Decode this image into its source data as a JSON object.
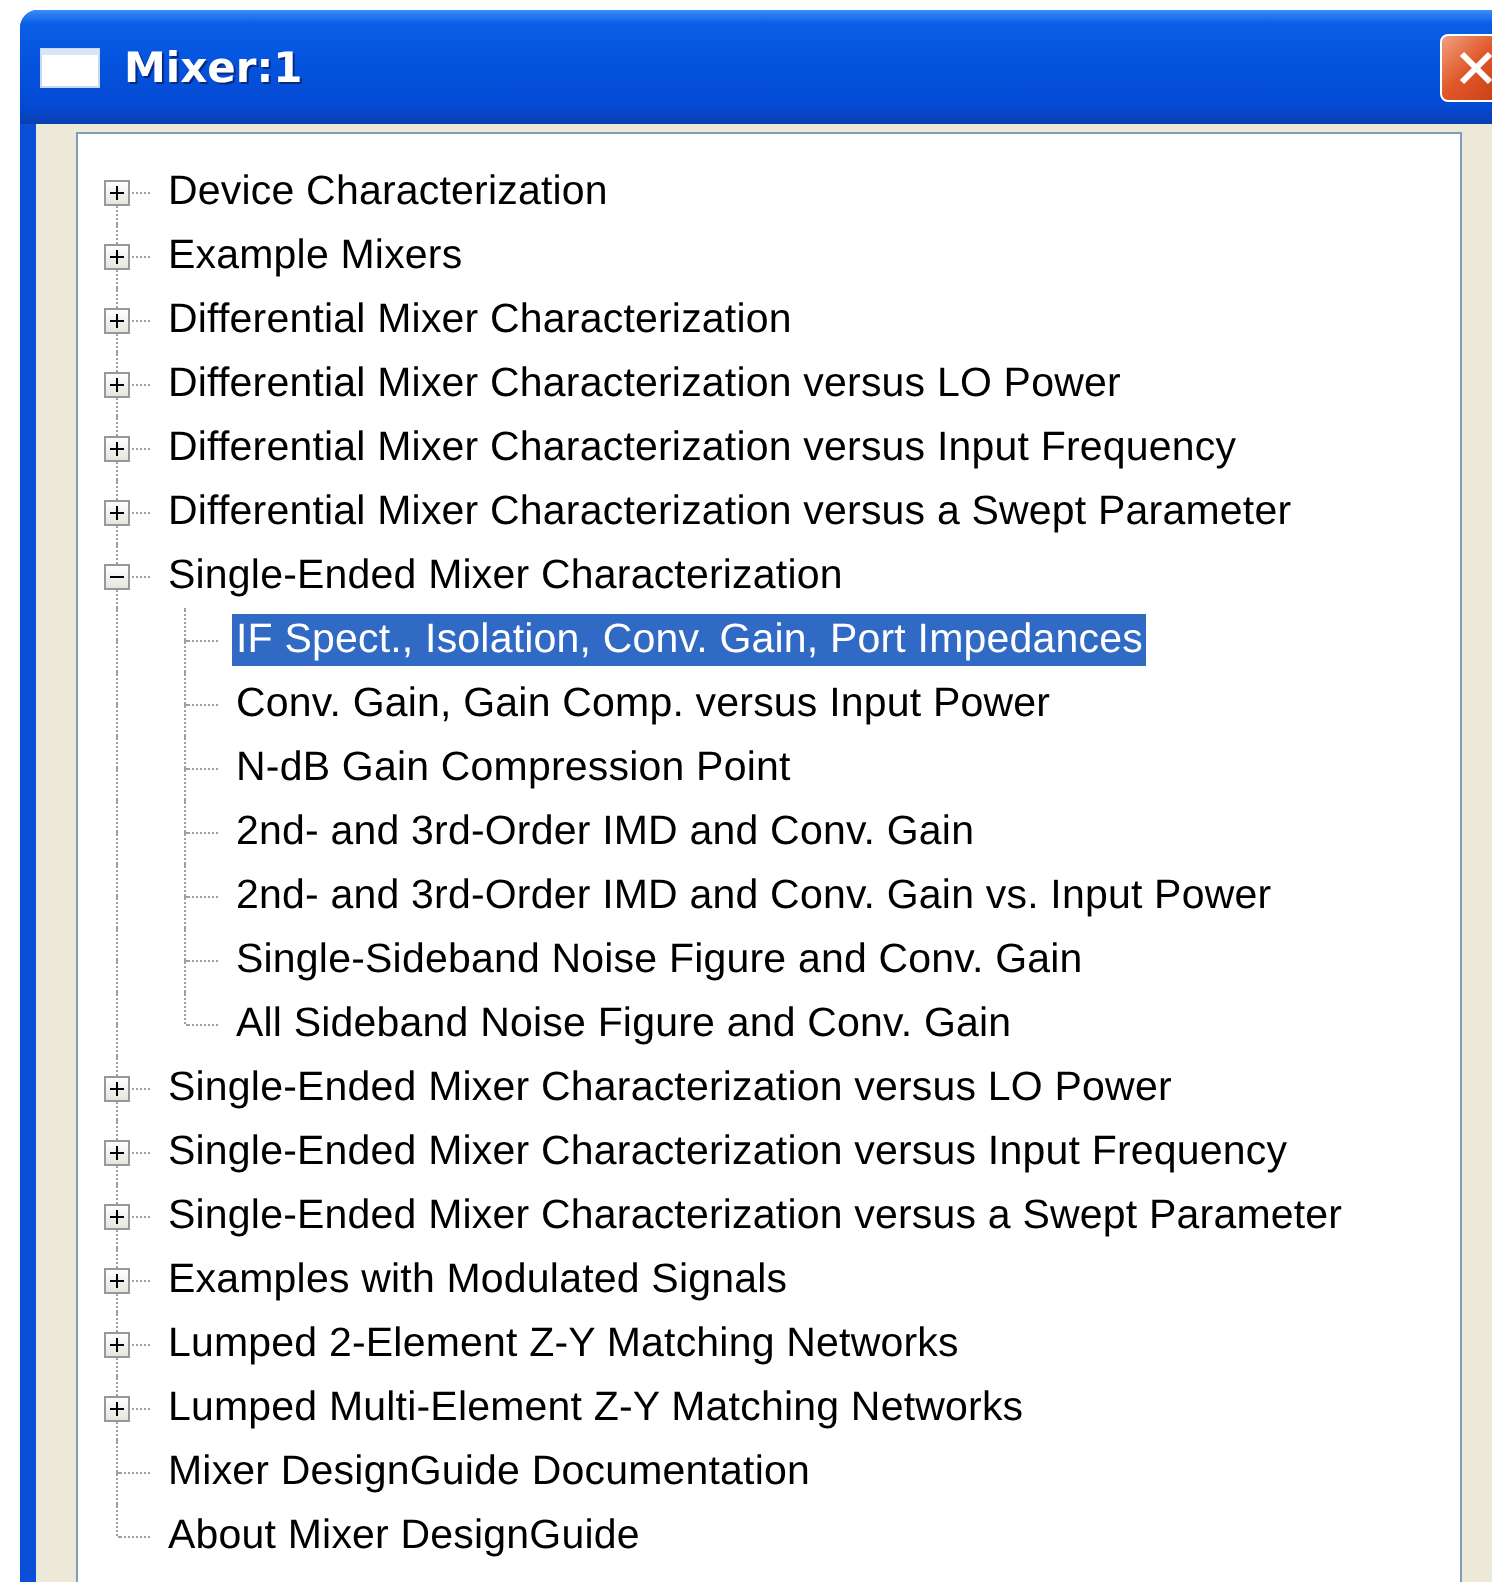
{
  "window": {
    "title": "Mixer:1"
  },
  "tree": [
    {
      "label": "Device Characterization",
      "kind": "node",
      "expanded": false,
      "selected": false
    },
    {
      "label": "Example Mixers",
      "kind": "node",
      "expanded": false,
      "selected": false
    },
    {
      "label": "Differential Mixer Characterization",
      "kind": "node",
      "expanded": false,
      "selected": false
    },
    {
      "label": "Differential Mixer Characterization versus LO Power",
      "kind": "node",
      "expanded": false,
      "selected": false
    },
    {
      "label": "Differential Mixer Characterization versus Input Frequency",
      "kind": "node",
      "expanded": false,
      "selected": false
    },
    {
      "label": "Differential Mixer Characterization versus a Swept Parameter",
      "kind": "node",
      "expanded": false,
      "selected": false
    },
    {
      "label": "Single-Ended Mixer Characterization",
      "kind": "node",
      "expanded": true,
      "selected": false,
      "children": [
        {
          "label": "IF Spect., Isolation, Conv. Gain, Port Impedances",
          "kind": "leaf",
          "selected": true
        },
        {
          "label": "Conv. Gain, Gain Comp. versus Input Power",
          "kind": "leaf",
          "selected": false
        },
        {
          "label": "N-dB Gain Compression Point",
          "kind": "leaf",
          "selected": false
        },
        {
          "label": "2nd- and 3rd-Order IMD and Conv. Gain",
          "kind": "leaf",
          "selected": false
        },
        {
          "label": "2nd- and 3rd-Order IMD and Conv. Gain vs. Input Power",
          "kind": "leaf",
          "selected": false
        },
        {
          "label": "Single-Sideband Noise Figure and Conv. Gain",
          "kind": "leaf",
          "selected": false
        },
        {
          "label": "All Sideband Noise Figure and Conv. Gain",
          "kind": "leaf",
          "selected": false
        }
      ]
    },
    {
      "label": "Single-Ended Mixer Characterization versus LO Power",
      "kind": "node",
      "expanded": false,
      "selected": false
    },
    {
      "label": "Single-Ended Mixer Characterization versus Input Frequency",
      "kind": "node",
      "expanded": false,
      "selected": false
    },
    {
      "label": "Single-Ended Mixer Characterization versus a Swept Parameter",
      "kind": "node",
      "expanded": false,
      "selected": false
    },
    {
      "label": "Examples with Modulated Signals",
      "kind": "node",
      "expanded": false,
      "selected": false
    },
    {
      "label": "Lumped 2-Element Z-Y Matching Networks",
      "kind": "node",
      "expanded": false,
      "selected": false
    },
    {
      "label": "Lumped Multi-Element Z-Y Matching Networks",
      "kind": "node",
      "expanded": false,
      "selected": false
    },
    {
      "label": "Mixer DesignGuide Documentation",
      "kind": "leaf",
      "selected": false
    },
    {
      "label": "About Mixer DesignGuide",
      "kind": "leaf",
      "selected": false
    }
  ]
}
